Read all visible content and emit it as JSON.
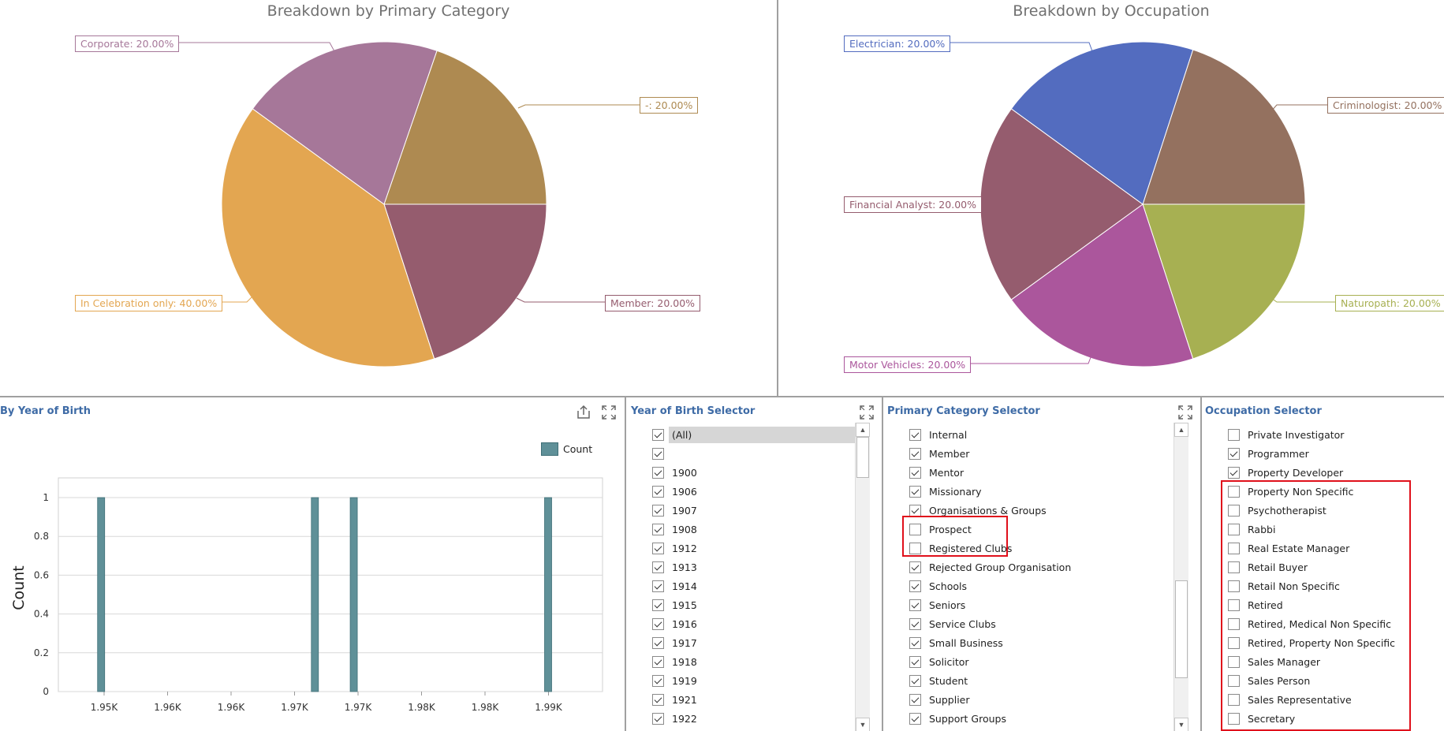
{
  "pie1": {
    "title": "Breakdown by Primary Category",
    "labels": {
      "corporate": "Corporate: 20.00%",
      "dash": "-: 20.00%",
      "celebration": "In Celebration only: 40.00%",
      "member": "Member: 20.00%"
    }
  },
  "pie2": {
    "title": "Breakdown by Occupation",
    "labels": {
      "electrician": "Electrician: 20.00%",
      "criminologist": "Criminologist: 20.00%",
      "financial": "Financial Analyst: 20.00%",
      "naturopath": "Naturopath: 20.00%",
      "motor": "Motor Vehicles: 20.00%"
    }
  },
  "colors": {
    "corporate": "#a67799",
    "dash": "#ae8a51",
    "celebration": "#e3a651",
    "member": "#955c6e",
    "electrician": "#536cbf",
    "criminologist": "#94715f",
    "financial": "#955c6e",
    "naturopath": "#a7b052",
    "motor": "#ab569c",
    "bar": "#5f9098",
    "highlight": "#e0101b",
    "title_blue": "#3e6ba6"
  },
  "year_chart": {
    "title": "By Year of Birth",
    "legend": "Count",
    "icons": [
      "export-icon",
      "maximize-icon"
    ]
  },
  "chart_data": {
    "type": "bar",
    "title": "By Year of Birth",
    "xlabel": "",
    "ylabel": "Count",
    "x_tick_labels": [
      "1.95K",
      "1.96K",
      "1.96K",
      "1.97K",
      "1.97K",
      "1.98K",
      "1.98K",
      "1.99K"
    ],
    "y_ticks": [
      "0",
      "0.2",
      "0.4",
      "0.6",
      "0.8",
      "1"
    ],
    "ylim": [
      0,
      1
    ],
    "series": [
      {
        "name": "Count",
        "x": [
          1948,
          1970,
          1974,
          1994
        ],
        "values": [
          1,
          1,
          1,
          1
        ]
      }
    ],
    "legend_position": "top-right",
    "grid": true
  },
  "year_selector": {
    "title": "Year of Birth Selector",
    "items": [
      {
        "label": "(All)",
        "checked": true
      },
      {
        "label": "",
        "checked": true
      },
      {
        "label": "1900",
        "checked": true
      },
      {
        "label": "1906",
        "checked": true
      },
      {
        "label": "1907",
        "checked": true
      },
      {
        "label": "1908",
        "checked": true
      },
      {
        "label": "1912",
        "checked": true
      },
      {
        "label": "1913",
        "checked": true
      },
      {
        "label": "1914",
        "checked": true
      },
      {
        "label": "1915",
        "checked": true
      },
      {
        "label": "1916",
        "checked": true
      },
      {
        "label": "1917",
        "checked": true
      },
      {
        "label": "1918",
        "checked": true
      },
      {
        "label": "1919",
        "checked": true
      },
      {
        "label": "1921",
        "checked": true
      },
      {
        "label": "1922",
        "checked": true
      }
    ]
  },
  "category_selector": {
    "title": "Primary Category Selector",
    "items": [
      {
        "label": "Internal",
        "checked": true
      },
      {
        "label": "Member",
        "checked": true
      },
      {
        "label": "Mentor",
        "checked": true
      },
      {
        "label": "Missionary",
        "checked": true
      },
      {
        "label": "Organisations & Groups",
        "checked": true
      },
      {
        "label": "Prospect",
        "checked": false
      },
      {
        "label": "Registered Clubs",
        "checked": false
      },
      {
        "label": "Rejected Group Organisation",
        "checked": true
      },
      {
        "label": "Schools",
        "checked": true
      },
      {
        "label": "Seniors",
        "checked": true
      },
      {
        "label": "Service Clubs",
        "checked": true
      },
      {
        "label": "Small Business",
        "checked": true
      },
      {
        "label": "Solicitor",
        "checked": true
      },
      {
        "label": "Student",
        "checked": true
      },
      {
        "label": "Supplier",
        "checked": true
      },
      {
        "label": "Support Groups",
        "checked": true
      }
    ]
  },
  "occupation_selector": {
    "title": "Occupation Selector",
    "items": [
      {
        "label": "Private Investigator",
        "checked": false
      },
      {
        "label": "Programmer",
        "checked": true
      },
      {
        "label": "Property Developer",
        "checked": true
      },
      {
        "label": "Property Non Specific",
        "checked": false
      },
      {
        "label": "Psychotherapist",
        "checked": false
      },
      {
        "label": "Rabbi",
        "checked": false
      },
      {
        "label": "Real Estate Manager",
        "checked": false
      },
      {
        "label": "Retail Buyer",
        "checked": false
      },
      {
        "label": "Retail Non Specific",
        "checked": false
      },
      {
        "label": "Retired",
        "checked": false
      },
      {
        "label": "Retired, Medical Non Specific",
        "checked": false
      },
      {
        "label": "Retired, Property Non Specific",
        "checked": false
      },
      {
        "label": "Sales Manager",
        "checked": false
      },
      {
        "label": "Sales Person",
        "checked": false
      },
      {
        "label": "Sales Representative",
        "checked": false
      },
      {
        "label": "Secretary",
        "checked": false
      }
    ]
  }
}
